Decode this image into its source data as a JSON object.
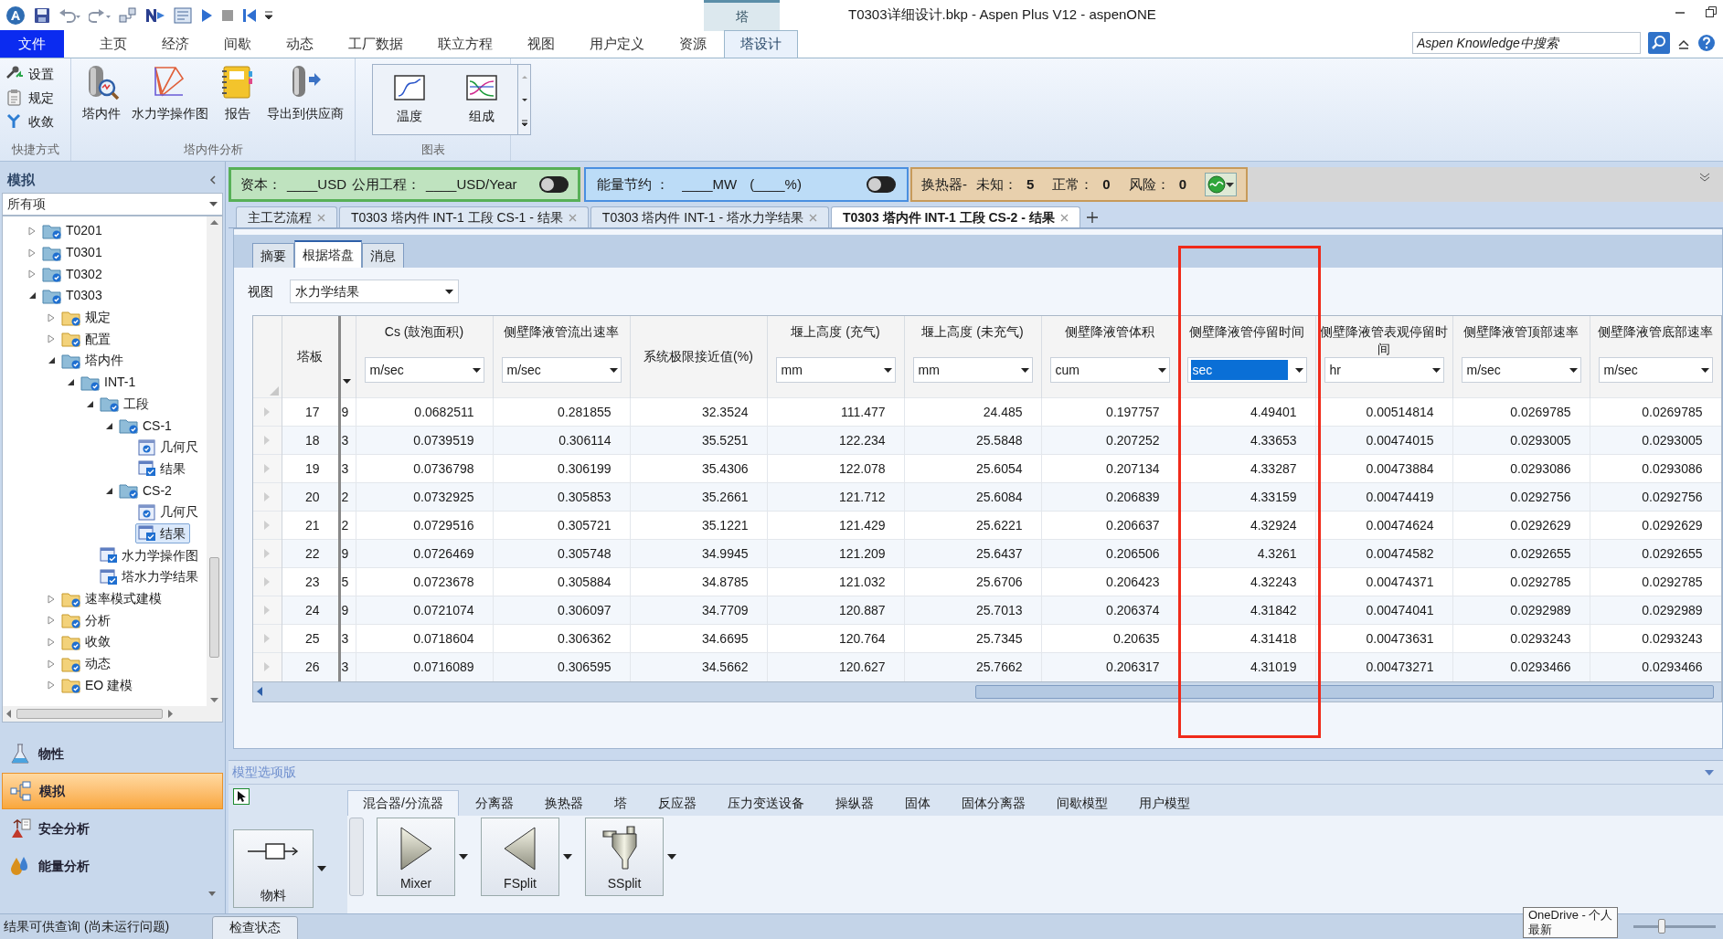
{
  "title_bar": {
    "title": "T0303详细设计.bkp - Aspen Plus V12 - aspenONE",
    "context_tab": "塔"
  },
  "menu_tabs": [
    {
      "label": "文件",
      "kind": "file",
      "selected": false
    },
    {
      "label": "主页",
      "kind": "tab",
      "selected": false
    },
    {
      "label": "经济",
      "kind": "tab",
      "selected": false
    },
    {
      "label": "间歇",
      "kind": "tab",
      "selected": false
    },
    {
      "label": "动态",
      "kind": "tab",
      "selected": false
    },
    {
      "label": "工厂数据",
      "kind": "tab",
      "selected": false
    },
    {
      "label": "联立方程",
      "kind": "tab",
      "selected": false
    },
    {
      "label": "视图",
      "kind": "tab",
      "selected": false
    },
    {
      "label": "用户定义",
      "kind": "tab",
      "selected": false
    },
    {
      "label": "资源",
      "kind": "tab",
      "selected": false
    },
    {
      "label": "塔设计",
      "kind": "tab",
      "selected": true
    }
  ],
  "search": {
    "placeholder": "Aspen Knowledge中搜索"
  },
  "ribbon_groups": [
    {
      "label": "快捷方式",
      "kind": "small",
      "items": [
        {
          "label": "设置",
          "kind": "setup"
        },
        {
          "label": "规定",
          "kind": "spec"
        },
        {
          "label": "收敛",
          "kind": "convergence"
        }
      ]
    },
    {
      "label": "塔内件分析",
      "kind": "large",
      "items": [
        {
          "label": "塔内件",
          "kind": "internals"
        },
        {
          "label": "水力学操作图",
          "kind": "hydraulic"
        },
        {
          "label": "报告",
          "kind": "report"
        },
        {
          "label": "导出到供应商",
          "kind": "export"
        }
      ]
    },
    {
      "label": "图表",
      "kind": "gallery",
      "items": [
        {
          "label": "温度",
          "kind": "temperature"
        },
        {
          "label": "组成",
          "kind": "composition"
        }
      ]
    }
  ],
  "strips": [
    {
      "kind": "capital",
      "texts": [
        "资本：",
        "____USD",
        "公用工程：",
        "____USD/Year"
      ],
      "toggle_on": false
    },
    {
      "kind": "energy",
      "texts": [
        "能量节约 ：",
        "____MW",
        "(____%)"
      ],
      "toggle_on": false
    },
    {
      "kind": "exchanger",
      "label": "换热器-",
      "counts": [
        {
          "label": "未知：",
          "value": "5"
        },
        {
          "label": "正常：",
          "value": "0"
        },
        {
          "label": "风险：",
          "value": "0"
        }
      ]
    }
  ],
  "doc_tabs": [
    {
      "label": "主工艺流程",
      "selected": false
    },
    {
      "label": "T0303 塔内件 INT-1 工段 CS-1 - 结果",
      "selected": false
    },
    {
      "label": "T0303 塔内件 INT-1 - 塔水力学结果",
      "selected": false
    },
    {
      "label": "T0303 塔内件 INT-1 工段 CS-2 - 结果",
      "selected": true
    }
  ],
  "sub_tabs": [
    {
      "label": "摘要",
      "selected": false
    },
    {
      "label": "根据塔盘",
      "selected": true
    },
    {
      "label": "消息",
      "selected": false
    }
  ],
  "view_select": {
    "label": "视图",
    "value": "水力学结果"
  },
  "table": {
    "columns": [
      {
        "kind": "index",
        "title": "塔板"
      },
      {
        "kind": "cut"
      },
      {
        "kind": "measure",
        "title": "Cs (鼓泡面积)",
        "unit": "m/sec",
        "unit_selected": false
      },
      {
        "kind": "measure",
        "title": "侧壁降液管流出速率",
        "unit": "m/sec",
        "unit_selected": false
      },
      {
        "kind": "plain",
        "title": "系统极限接近值(%)"
      },
      {
        "kind": "measure",
        "title": "堰上高度 (充气)",
        "unit": "mm",
        "unit_selected": false
      },
      {
        "kind": "measure",
        "title": "堰上高度 (未充气)",
        "unit": "mm",
        "unit_selected": false
      },
      {
        "kind": "measure",
        "title": "侧壁降液管体积",
        "unit": "cum",
        "unit_selected": false
      },
      {
        "kind": "measure",
        "title": "侧壁降液管停留时间",
        "unit": "sec",
        "unit_selected": true
      },
      {
        "kind": "measure",
        "title": "侧壁降液管表观停留时间",
        "unit": "hr",
        "unit_selected": false
      },
      {
        "kind": "measure",
        "title": "侧壁降液管顶部速率",
        "unit": "m/sec",
        "unit_selected": false
      },
      {
        "kind": "measure",
        "title": "侧壁降液管底部速率",
        "unit": "m/sec",
        "unit_selected": false
      }
    ],
    "rows": [
      {
        "cells": [
          "17",
          "9",
          "0.0682511",
          "0.281855",
          "32.3524",
          "111.477",
          "24.485",
          "0.197757",
          "4.49401",
          "0.00514814",
          "0.0269785",
          "0.0269785"
        ]
      },
      {
        "cells": [
          "18",
          "3",
          "0.0739519",
          "0.306114",
          "35.5251",
          "122.234",
          "25.5848",
          "0.207252",
          "4.33653",
          "0.00474015",
          "0.0293005",
          "0.0293005"
        ]
      },
      {
        "cells": [
          "19",
          "3",
          "0.0736798",
          "0.306199",
          "35.4306",
          "122.078",
          "25.6054",
          "0.207134",
          "4.33287",
          "0.00473884",
          "0.0293086",
          "0.0293086"
        ]
      },
      {
        "cells": [
          "20",
          "2",
          "0.0732925",
          "0.305853",
          "35.2661",
          "121.712",
          "25.6084",
          "0.206839",
          "4.33159",
          "0.00474419",
          "0.0292756",
          "0.0292756"
        ]
      },
      {
        "cells": [
          "21",
          "2",
          "0.0729516",
          "0.305721",
          "35.1221",
          "121.429",
          "25.6221",
          "0.206637",
          "4.32924",
          "0.00474624",
          "0.0292629",
          "0.0292629"
        ]
      },
      {
        "cells": [
          "22",
          "9",
          "0.0726469",
          "0.305748",
          "34.9945",
          "121.209",
          "25.6437",
          "0.206506",
          "4.3261",
          "0.00474582",
          "0.0292655",
          "0.0292655"
        ]
      },
      {
        "cells": [
          "23",
          "5",
          "0.0723678",
          "0.305884",
          "34.8785",
          "121.032",
          "25.6706",
          "0.206423",
          "4.32243",
          "0.00474371",
          "0.0292785",
          "0.0292785"
        ]
      },
      {
        "cells": [
          "24",
          "9",
          "0.0721074",
          "0.306097",
          "34.7709",
          "120.887",
          "25.7013",
          "0.206374",
          "4.31842",
          "0.00474041",
          "0.0292989",
          "0.0292989"
        ]
      },
      {
        "cells": [
          "25",
          "3",
          "0.0718604",
          "0.306362",
          "34.6695",
          "120.764",
          "25.7345",
          "0.20635",
          "4.31418",
          "0.00473631",
          "0.0293243",
          "0.0293243"
        ]
      },
      {
        "cells": [
          "26",
          "3",
          "0.0716089",
          "0.306595",
          "34.5662",
          "120.627",
          "25.7662",
          "0.206317",
          "4.31019",
          "0.00473271",
          "0.0293466",
          "0.0293466"
        ]
      }
    ]
  },
  "left_pane": {
    "title": "模拟",
    "filter": "所有项",
    "tree": [
      {
        "label": "T0201",
        "kind": "block",
        "expanded": false,
        "selected": false
      },
      {
        "label": "T0301",
        "kind": "block",
        "expanded": false,
        "selected": false
      },
      {
        "label": "T0302",
        "kind": "block",
        "expanded": false,
        "selected": false
      },
      {
        "label": "T0303",
        "kind": "block",
        "expanded": true,
        "selected": false,
        "children": [
          {
            "label": "规定",
            "kind": "folder",
            "expanded": false,
            "selected": false
          },
          {
            "label": "配置",
            "kind": "folder",
            "expanded": false,
            "selected": false
          },
          {
            "label": "塔内件",
            "kind": "block",
            "expanded": true,
            "selected": false,
            "children": [
              {
                "label": "INT-1",
                "kind": "block",
                "expanded": true,
                "selected": false,
                "children": [
                  {
                    "label": "工段",
                    "kind": "block",
                    "expanded": true,
                    "selected": false,
                    "children": [
                      {
                        "label": "CS-1",
                        "kind": "block",
                        "expanded": true,
                        "selected": false,
                        "children": [
                          {
                            "label": "几何尺",
                            "kind": "form",
                            "selected": false
                          },
                          {
                            "label": "结果",
                            "kind": "result",
                            "selected": false
                          }
                        ]
                      },
                      {
                        "label": "CS-2",
                        "kind": "block",
                        "expanded": true,
                        "selected": false,
                        "children": [
                          {
                            "label": "几何尺",
                            "kind": "form",
                            "selected": false
                          },
                          {
                            "label": "结果",
                            "kind": "result",
                            "selected": true
                          }
                        ]
                      }
                    ]
                  },
                  {
                    "label": "水力学操作图",
                    "kind": "result",
                    "selected": false
                  },
                  {
                    "label": "塔水力学结果",
                    "kind": "result",
                    "selected": false
                  }
                ]
              }
            ]
          },
          {
            "label": "速率模式建模",
            "kind": "folder",
            "expanded": false,
            "selected": false
          },
          {
            "label": "分析",
            "kind": "folder",
            "expanded": false,
            "selected": false
          },
          {
            "label": "收敛",
            "kind": "folder",
            "expanded": false,
            "selected": false
          },
          {
            "label": "动态",
            "kind": "folder",
            "expanded": false,
            "selected": false
          },
          {
            "label": "EO 建模",
            "kind": "folder",
            "expanded": false,
            "selected": false
          }
        ]
      }
    ],
    "nav": [
      {
        "label": "物性",
        "kind": "properties",
        "selected": false
      },
      {
        "label": "模拟",
        "kind": "simulation",
        "selected": true
      },
      {
        "label": "安全分析",
        "kind": "safety",
        "selected": false
      },
      {
        "label": "能量分析",
        "kind": "energy",
        "selected": false
      }
    ]
  },
  "palette": {
    "title": "模型选项版",
    "tabs": [
      {
        "label": "混合器/分流器",
        "selected": true
      },
      {
        "label": "分离器",
        "selected": false
      },
      {
        "label": "换热器",
        "selected": false
      },
      {
        "label": "塔",
        "selected": false
      },
      {
        "label": "反应器",
        "selected": false
      },
      {
        "label": "压力变送设备",
        "selected": false
      },
      {
        "label": "操纵器",
        "selected": false
      },
      {
        "label": "固体",
        "selected": false
      },
      {
        "label": "固体分离器",
        "selected": false
      },
      {
        "label": "间歇模型",
        "selected": false
      },
      {
        "label": "用户模型",
        "selected": false
      }
    ],
    "items": [
      {
        "label": "物料",
        "kind": "stream"
      },
      {
        "label": "Mixer",
        "kind": "mixer"
      },
      {
        "label": "FSplit",
        "kind": "fsplit"
      },
      {
        "label": "SSplit",
        "kind": "ssplit"
      }
    ]
  },
  "status_bar": {
    "message": "结果可供查询 (尚未运行问题)",
    "button": "检查状态",
    "tooltip": [
      "OneDrive - 个人",
      "最新"
    ]
  },
  "annotations": [
    {
      "kind": "rectangle"
    }
  ]
}
